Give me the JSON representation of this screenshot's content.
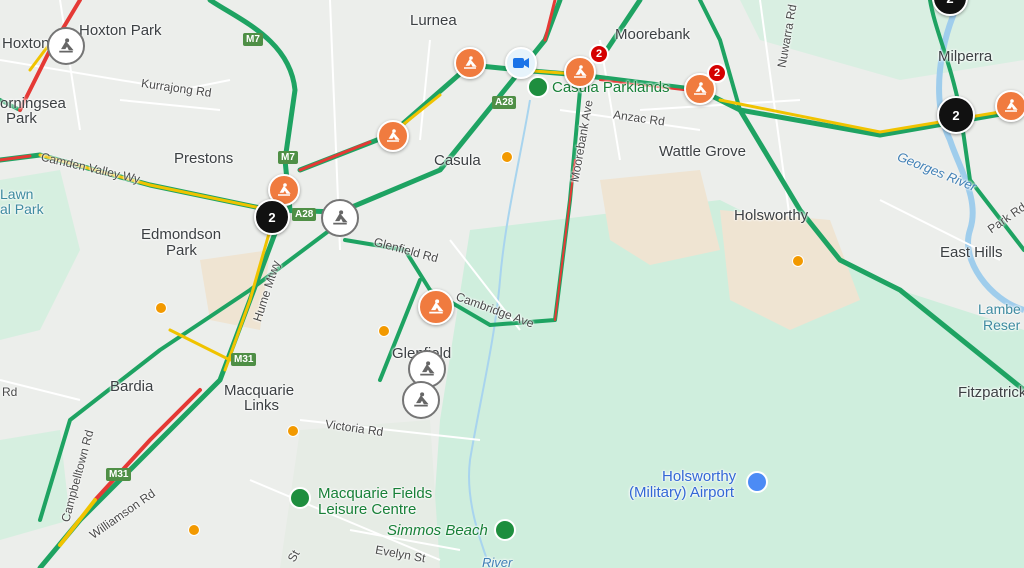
{
  "suburbs": {
    "hoxton": "Hoxton",
    "hoxton_park": "Hoxton Park",
    "lurnea": "Lurnea",
    "moorebank": "Moorebank",
    "milperra": "Milperra",
    "morningsea": "orningsea",
    "park_1": "Park",
    "prestons": "Prestons",
    "casula": "Casula",
    "wattle_grove": "Wattle Grove",
    "lawn": "Lawn",
    "park_2": "al Park",
    "holsworthy": "Holsworthy",
    "edmondson": "Edmondson",
    "park_3": "Park",
    "east_hills": "East Hills",
    "lambeth": "Lambe",
    "reserve": "Reser",
    "glenfield": "Glenfield",
    "bardia": "Bardia",
    "macquarie": "Macquarie",
    "links": "Links",
    "fitzpatrick": "Fitzpatrick"
  },
  "roads": {
    "kurrajong": "Kurrajong Rd",
    "camden_valley": "Camden Valley Wy",
    "anzac": "Anzac Rd",
    "nuwarra": "Nuwarra Rd",
    "moorebank_ave": "Moorebank Ave",
    "glenfield_rd": "Glenfield Rd",
    "cambridge": "Cambridge Ave",
    "hume": "Hume Mtwy",
    "victoria": "Victoria Rd",
    "campbelltown": "Campbelltown Rd",
    "williamson": "Williamson Rd",
    "park_rd": "Park Rd",
    "evelyn": "Evelyn St",
    "st": "St",
    "rd_left": "Rd"
  },
  "shields": {
    "m7_a": "M7",
    "m7_b": "M7",
    "a28_a": "A28",
    "a28_b": "A28",
    "m31_a": "M31",
    "m31_b": "M31"
  },
  "places": {
    "casula_parklands": "Casula Parklands",
    "mqf_leisure_1": "Macquarie Fields",
    "mqf_leisure_2": "Leisure Centre",
    "simmos": "Simmos Beach",
    "airport_1": "Holsworthy",
    "airport_2": "(Military) Airport",
    "georges_river": "Georges River",
    "river_bottom": "River"
  },
  "clusters": {
    "c1": "2",
    "c2": "2",
    "c3": "2"
  },
  "badges": {
    "b1": "2",
    "b2": "2"
  },
  "colors": {
    "traffic_green": "#1ea362",
    "traffic_yellow": "#f0c300",
    "traffic_red": "#e53935",
    "roadwork": "#f07b3f"
  },
  "icons": {
    "roadwork": "roadwork-icon",
    "camera": "camera-icon",
    "park": "park-icon",
    "airport": "airport-icon"
  }
}
